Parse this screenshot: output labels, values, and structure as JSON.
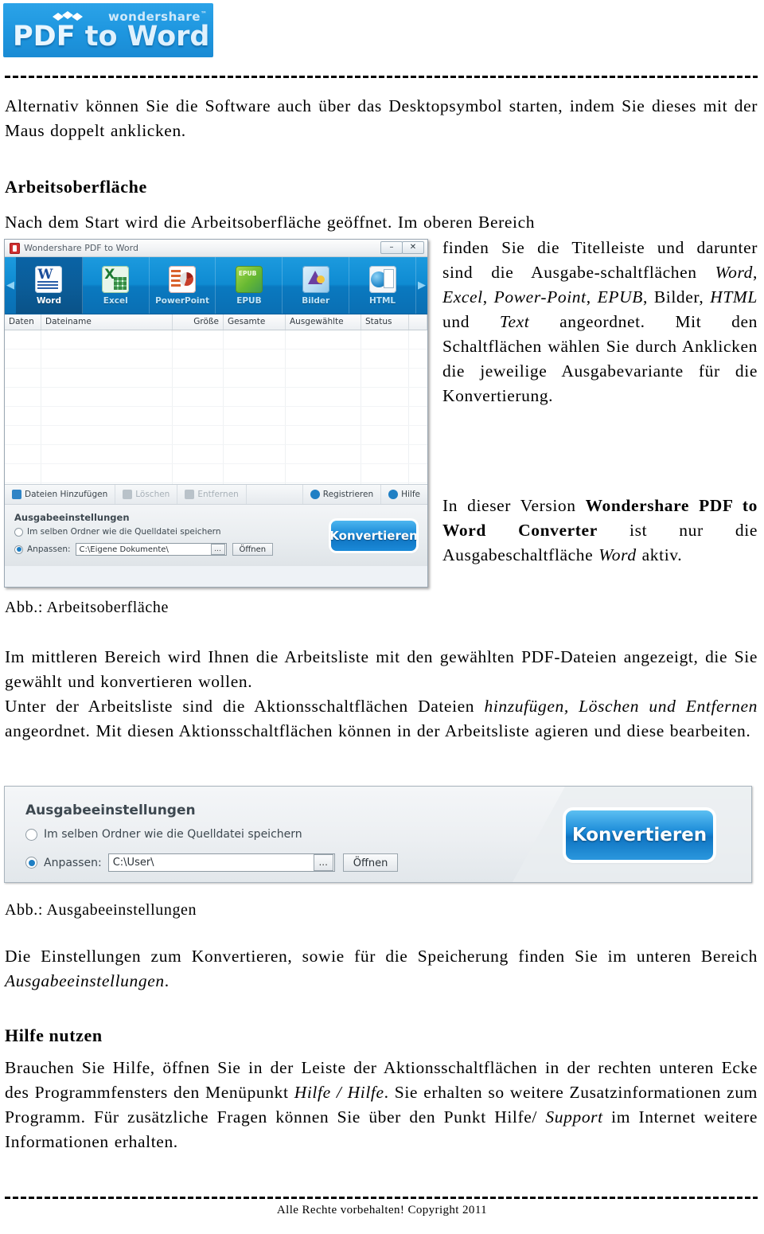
{
  "logo": {
    "brand": "wondershare",
    "tm": "™",
    "product_pdf": "PDF",
    "product_rest": " to Word"
  },
  "body": {
    "intro": "Alternativ können Sie die Software auch über das Desktopsymbol starten, indem Sie dieses mit der Maus doppelt anklicken.",
    "heading_workspace": "Arbeitsoberfläche",
    "p_workspace_1_a": "Nach dem Start wird die Arbeitsoberfläche geöffnet. Im oberen Bereich finden Sie die Titelleiste und darunter sind die Ausgabe-schaltflächen ",
    "p_workspace_em1": "Word",
    "p_workspace_sep1": ", ",
    "p_workspace_em2": "Excel",
    "p_workspace_sep2": ", ",
    "p_workspace_em3": "Power-Point",
    "p_workspace_sep3": ", ",
    "p_workspace_em4": "EPUB",
    "p_workspace_sep4": ", Bilder, ",
    "p_workspace_em5": "HTML",
    "p_workspace_sep5": " und ",
    "p_workspace_em6": "Text",
    "p_workspace_1_b": " angeordnet. Mit den Schaltflächen wählen Sie durch Anklicken die jeweilige Ausgabevariante für die Konvertierung.",
    "p_version_a": "In dieser Version ",
    "p_version_bold": "Wondershare PDF to Word Converter",
    "p_version_b": " ist nur die Ausgabeschaltfläche ",
    "p_version_em": "Word",
    "p_version_c": " aktiv.",
    "caption_workspace": "Abb.: Arbeitsoberfläche",
    "p_middle_a": "Im mittleren Bereich wird Ihnen die Arbeitsliste mit den gewählten PDF-Dateien angezeigt, die Sie gewählt und konvertieren wollen.",
    "p_middle_b1": "Unter der Arbeitsliste sind die Aktionsschaltflächen Dateien ",
    "p_middle_em1": "hinzufügen, Löschen und Entfernen",
    "p_middle_b2": " angeordnet. Mit diesen Aktionsschaltflächen können in der Arbeitsliste agieren und diese bearbeiten.",
    "caption_output": "Abb.: Ausgabeeinstellungen",
    "p_settings_a": "Die Einstellungen zum Konvertieren, sowie für die Speicherung finden Sie im unteren Bereich ",
    "p_settings_em": "Ausgabeeinstellungen",
    "p_settings_b": ".",
    "heading_help": "Hilfe nutzen",
    "p_help_a": "Brauchen Sie Hilfe, öffnen Sie in der Leiste der Aktionsschaltflächen in der rechten unteren Ecke des Programmfensters den Menüpunkt ",
    "p_help_em1": "Hilfe / Hilfe",
    "p_help_b": ". Sie erhalten so weitere Zusatzinformationen zum Programm. Für zusätzliche Fragen können Sie über den Punkt Hilfe/ ",
    "p_help_em2": "Support",
    "p_help_c": " im Internet weitere Informationen erhalten.",
    "footer": "Alle Rechte vorbehalten! Copyright 2011"
  },
  "screenshot_main": {
    "window_title": "Wondershare PDF to Word",
    "minimize_label": "–",
    "close_label": "✕",
    "ribbon": [
      {
        "label": "Word",
        "icon": "word-doc-icon"
      },
      {
        "label": "Excel",
        "icon": "excel-sheet-icon"
      },
      {
        "label": "PowerPoint",
        "icon": "powerpoint-slide-icon"
      },
      {
        "label": "EPUB",
        "icon": "epub-book-icon"
      },
      {
        "label": "Bilder",
        "icon": "image-icon"
      },
      {
        "label": "HTML",
        "icon": "html-globe-icon"
      }
    ],
    "ribbon_active": "Word",
    "table_headers": [
      "Daten",
      "Dateiname",
      "Größe",
      "Gesamte Seiten",
      "Ausgewählte Seiten",
      "Status"
    ],
    "action_buttons": [
      {
        "label": "Dateien Hinzufügen",
        "state": "enabled"
      },
      {
        "label": "Löschen",
        "state": "disabled"
      },
      {
        "label": "Entfernen",
        "state": "disabled"
      }
    ],
    "right_buttons": [
      {
        "label": "Registrieren"
      },
      {
        "label": "Hilfe"
      }
    ],
    "output_panel": {
      "title": "Ausgabeeinstellungen",
      "option_same_folder": "Im selben Ordner wie die Quelldatei speichern",
      "option_custom": "Anpassen:",
      "path_value": "C:\\Eigene Dokumente\\",
      "browse_label": "...",
      "open_label": "Öffnen",
      "convert_label": "Konvertieren",
      "selected_option": "custom"
    }
  },
  "screenshot_output": {
    "title": "Ausgabeeinstellungen",
    "option_same_folder": "Im selben Ordner wie die Quelldatei speichern",
    "option_custom": "Anpassen:",
    "path_value": "C:\\User\\",
    "browse_label": "...",
    "open_label": "Öffnen",
    "convert_label": "Konvertieren",
    "selected_option": "custom"
  },
  "colors": {
    "brand_blue": "#1b8ad8",
    "ribbon_blue": "#0f8bd2",
    "accent_dark": "#0a5288"
  }
}
